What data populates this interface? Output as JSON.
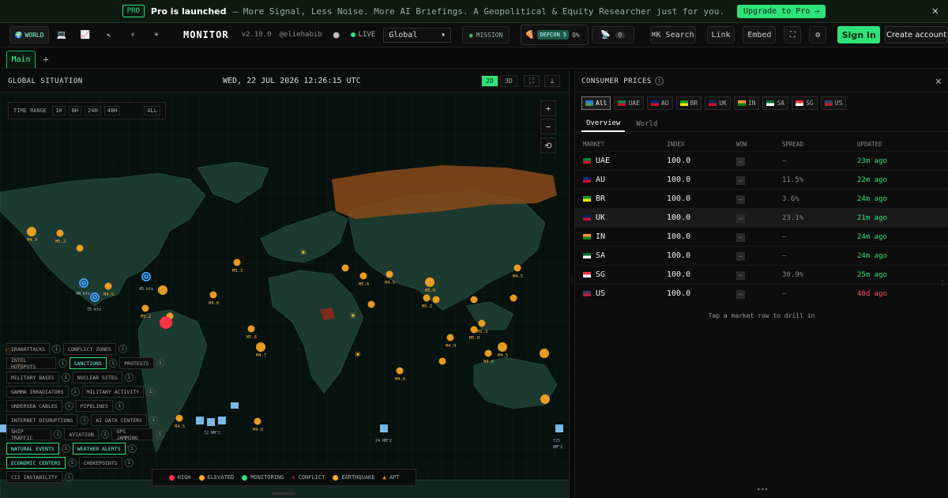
{
  "banner": {
    "badge": "PRO",
    "title": "Pro is launched",
    "text": "– More Signal, Less Noise. More AI Briefings. A Geopolitical & Equity Researcher just for you.",
    "cta": "Upgrade to Pro →",
    "close": "✕"
  },
  "header": {
    "variant_label": "WORLD",
    "brand": "MONITOR",
    "version": "v2.10.0",
    "handle": "@eliehabib",
    "live": "LIVE",
    "region": "Global",
    "mission": "MISSION",
    "defcon": "DEFCON 5",
    "defcon_pct": "0%",
    "alerts_count": "0",
    "search": "⌘K Search",
    "link": "Link",
    "embed": "Embed",
    "signin": "Sign In",
    "create": "Create account"
  },
  "tabs": {
    "main": "Main",
    "add": "+"
  },
  "map": {
    "title": "GLOBAL SITUATION",
    "date": "WED, 22 JUL 2026 12:26:15 UTC",
    "view_2d": "2D",
    "view_3d": "3D",
    "time_range": {
      "label": "TIME RANGE",
      "options": [
        "1H",
        "6H",
        "24H",
        "48H",
        "ALL"
      ]
    },
    "zoom_in": "+",
    "zoom_out": "−",
    "reset": "⟲",
    "layers": [
      [
        "IRANATTACKS",
        "CONFLICT ZONES"
      ],
      [
        "INTEL HOTSPOTS",
        "SANCTIONS",
        "PROTESTS"
      ],
      [
        "MILITARY BASES",
        "NUCLEAR SITES"
      ],
      [
        "GAMMA IRRADIATORS",
        "MILITARY ACTIVITY"
      ],
      [
        "UNDERSEA CABLES",
        "PIPELINES"
      ],
      [
        "INTERNET DISRUPTIONS",
        "AI DATA CENTERS"
      ],
      [
        "SHIP TRAFFIC",
        "AVIATION",
        "GPS JAMMING"
      ],
      [
        "NATURAL EVENTS",
        "WEATHER ALERTS"
      ],
      [
        "ECONOMIC CENTERS",
        "CHOKEPOINTS"
      ],
      [
        "CII INSTABILITY"
      ]
    ],
    "active_layers": [
      "SANCTIONS",
      "NATURAL EVENTS",
      "WEATHER ALERTS",
      "ECONOMIC CENTERS"
    ],
    "info": "i",
    "legend": [
      "HIGH",
      "ELEVATED",
      "MONITORING",
      "CONFLICT",
      "EARTHQUAKE",
      "APT"
    ],
    "legend_colors": [
      "#ff3344",
      "#ffaa22",
      "#2ee37a",
      "#ff4444",
      "#ffaa22",
      "#ff9933"
    ],
    "quake_labels": [
      "M4.9",
      "M5.2",
      "M5.3",
      "M4.5",
      "M4.8",
      "M5.2",
      "M5.6",
      "M4.7",
      "M4.6",
      "M4.5",
      "M5.8",
      "M5.0",
      "M4.5",
      "M5.3",
      "M4.5",
      "M4.9",
      "M5.2",
      "M5.0",
      "M4.6",
      "M4.8",
      "M4.5"
    ],
    "storm_labels": [
      "40 kts",
      "75 kts",
      "45 kts"
    ],
    "cable_labels": [
      "24 NM^2",
      "72 NM^2",
      "725",
      "NM^2"
    ]
  },
  "prices": {
    "title": "CONSUMER PRICES",
    "help": "?",
    "close": "✕",
    "countries": [
      "All",
      "UAE",
      "AU",
      "BR",
      "UK",
      "IN",
      "SA",
      "SG",
      "US"
    ],
    "subtabs": [
      "Overview",
      "World"
    ],
    "columns": [
      "MARKET",
      "INDEX",
      "WOW",
      "SPREAD",
      "UPDATED"
    ],
    "rows": [
      {
        "market": "UAE",
        "index": "100.0",
        "wow": "–",
        "spread": "–",
        "updated": "23m ago"
      },
      {
        "market": "AU",
        "index": "100.0",
        "wow": "–",
        "spread": "11.5%",
        "updated": "22m ago"
      },
      {
        "market": "BR",
        "index": "100.0",
        "wow": "–",
        "spread": "3.6%",
        "updated": "24m ago"
      },
      {
        "market": "UK",
        "index": "100.0",
        "wow": "–",
        "spread": "23.1%",
        "updated": "21m ago"
      },
      {
        "market": "IN",
        "index": "100.0",
        "wow": "–",
        "spread": "–",
        "updated": "24m ago"
      },
      {
        "market": "SA",
        "index": "100.0",
        "wow": "–",
        "spread": "–",
        "updated": "24m ago"
      },
      {
        "market": "SG",
        "index": "100.0",
        "wow": "–",
        "spread": "30.9%",
        "updated": "25m ago"
      },
      {
        "market": "US",
        "index": "100.0",
        "wow": "–",
        "spread": "–",
        "updated": "40d ago"
      }
    ],
    "hint": "Tap a market row to drill in"
  },
  "colors": {
    "accent": "#2ee37a",
    "stale": "#ff5566",
    "quake": "#ffaa22",
    "land": "#1c3a30",
    "sanction": "#8a4a1a"
  }
}
